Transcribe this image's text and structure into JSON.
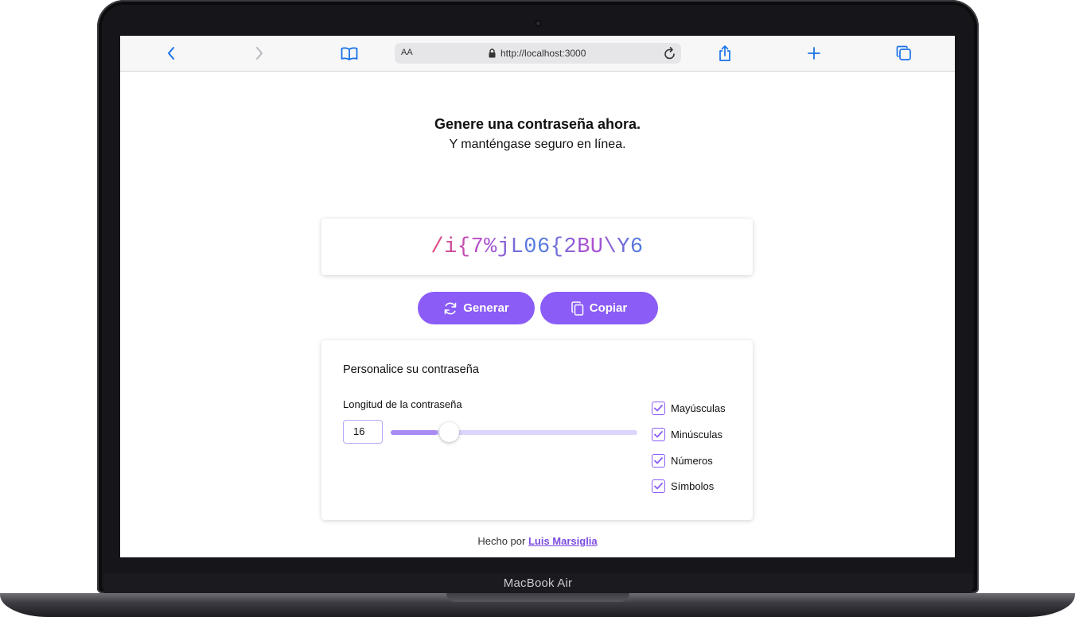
{
  "device": {
    "label": "MacBook Air"
  },
  "browser": {
    "text_size_label": "AA",
    "url": "http://localhost:3000",
    "icons": [
      "back-icon",
      "forward-icon",
      "bookmarks-icon",
      "lock-icon",
      "reload-icon",
      "share-icon",
      "new-tab-icon",
      "tabs-icon"
    ],
    "accent_color": "#1a73e8"
  },
  "header": {
    "title": "Genere una contraseña ahora.",
    "subtitle": "Y manténgase seguro en línea."
  },
  "password": {
    "value": "/i{7%jL06{2BU\\Y6",
    "colors": [
      "#e04b7a",
      "#b14cd0",
      "#4a7fe0"
    ]
  },
  "actions": {
    "generate_label": "Generar",
    "copy_label": "Copiar",
    "generate_icon": "refresh-icon",
    "copy_icon": "copy-icon",
    "button_color": "#8b5cf6"
  },
  "customize": {
    "title": "Personalice su contraseña",
    "length_label": "Longitud de la contraseña",
    "length_value": "16",
    "slider": {
      "min": 1,
      "max": 100,
      "value": 16
    },
    "options": [
      {
        "label": "Mayúsculas",
        "checked": true
      },
      {
        "label": "Minúsculas",
        "checked": true
      },
      {
        "label": "Números",
        "checked": true
      },
      {
        "label": "Símbolos",
        "checked": true
      }
    ]
  },
  "footer": {
    "prefix": "Hecho por",
    "author": "Luis Marsiglia"
  }
}
